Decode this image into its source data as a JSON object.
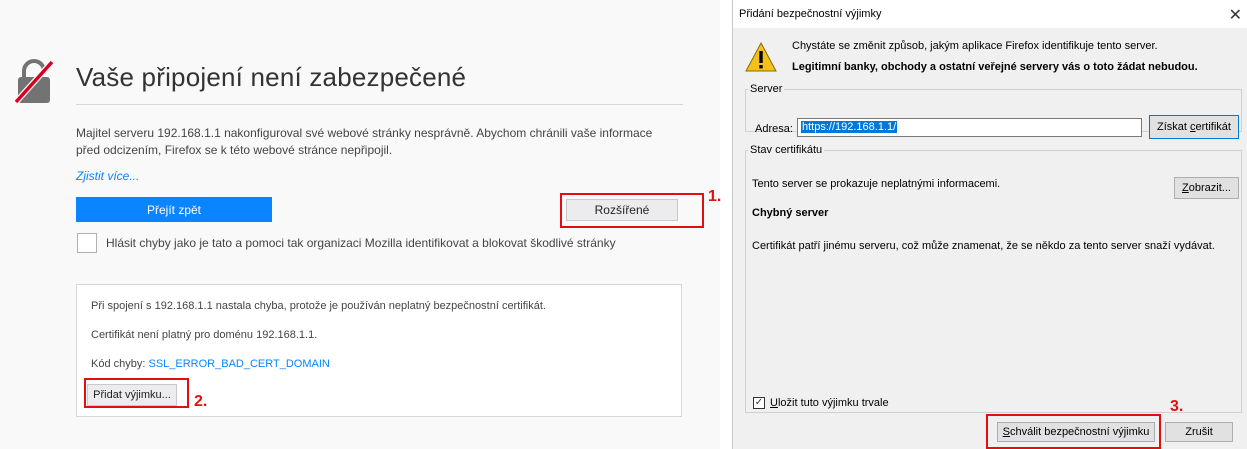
{
  "error_page": {
    "lock_icon": "broken-lock-icon",
    "title": "Vaše připojení není zabezpečené",
    "description": "Majitel serveru 192.168.1.1 nakonfiguroval své webové stránky nesprávně. Abychom chránili vaše informace před odcizením, Firefox se k této webové stránce nepřipojil.",
    "learn_more": "Zjistit více...",
    "go_back_label": "Přejít zpět",
    "advanced_label": "Rozšířené",
    "report_label": "Hlásit chyby jako je tato a pomoci tak organizaci Mozilla identifikovat a blokovat škodlivé stránky",
    "details": {
      "line1": "Při spojení s 192.168.1.1 nastala chyba, protože je používán neplatný bezpečnostní certifikát.",
      "line2": "Certifikát není platný pro doménu 192.168.1.1.",
      "code_prefix": "Kód chyby: ",
      "code": "SSL_ERROR_BAD_CERT_DOMAIN",
      "add_exception_label": "Přidat výjimku..."
    }
  },
  "annotations": {
    "step1": "1.",
    "step2": "2.",
    "step3": "3.",
    "color": "#e01010"
  },
  "dialog": {
    "title": "Přidání bezpečnostní výjimky",
    "close_icon": "close-icon",
    "warning_icon": "warning-triangle-icon",
    "warning_line1": "Chystáte se změnit způsob, jakým aplikace Firefox identifikuje tento server.",
    "warning_line2": "Legitimní banky, obchody a ostatní veřejné servery vás o toto žádat nebudou.",
    "server": {
      "legend": "Server",
      "address_label": "Adresa:",
      "address_value": "https://192.168.1.1/",
      "get_cert_pre": "Získat ",
      "get_cert_ul": "c",
      "get_cert_post": "ertifikát"
    },
    "cert_status": {
      "legend": "Stav certifikátu",
      "status_text": "Tento server se prokazuje neplatnými informacemi.",
      "view_ul": "Z",
      "view_post": "obrazit...",
      "bad_server_title": "Chybný server",
      "bad_server_desc": "Certifikát patří jinému serveru, což může znamenat, že se někdo za tento server snaží vydávat."
    },
    "permanent_checked": true,
    "permanent_ul": "U",
    "permanent_post": "ložit tuto výjimku trvale",
    "confirm_ul": "S",
    "confirm_post": "chválit bezpečnostní výjimku",
    "cancel_label": "Zrušit"
  }
}
